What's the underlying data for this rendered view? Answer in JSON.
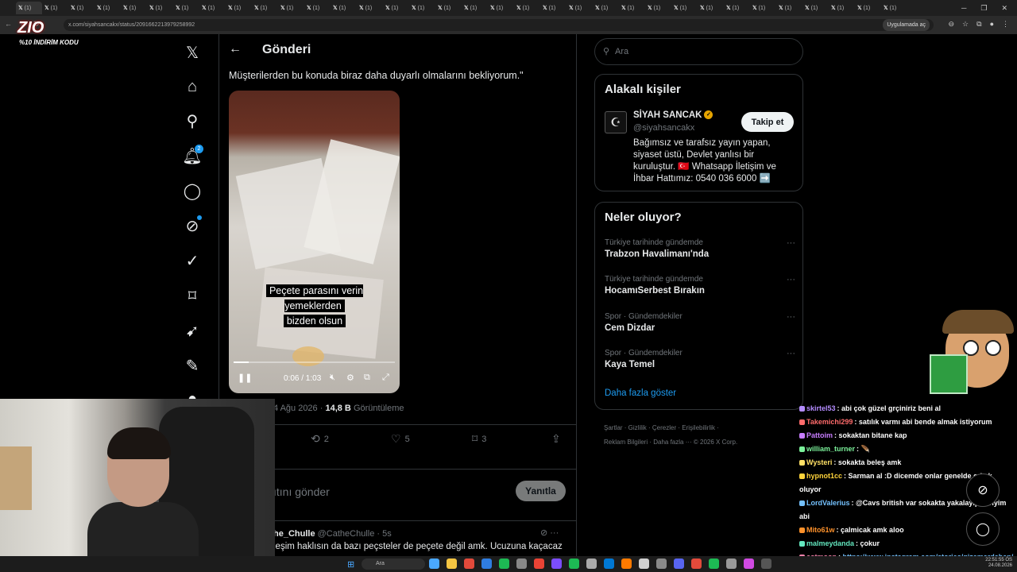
{
  "browser": {
    "tab_label": "(1)",
    "url": "x.com/siyahsancakx/status/2091662213979258992",
    "app_mode": "Uygulamada aç"
  },
  "overlay": {
    "brand": "ZIO",
    "promo": "%10 İNDİRİM KODU"
  },
  "nav": {
    "notification_count": "2"
  },
  "post": {
    "header_title": "Gönderi",
    "text": "Müşterilerden bu konuda biraz daha duyarlı olmalarını bekliyorum.\"",
    "video_caption_line1": "Peçete parasını verin yemeklerden",
    "video_caption_line2": "bizden olsun",
    "video_time": "0:06 / 1:03",
    "video_progress": 0.095,
    "date": "4 Ağu 2026",
    "views_count": "14,8 B",
    "views_label": "Görüntüleme",
    "reposts": "2",
    "likes": "5",
    "bookmarks": "3",
    "reply_placeholder": "ıtını gönder",
    "reply_button": "Yanıtla"
  },
  "reply": {
    "author": "he_Chulle",
    "handle": "@CatheChulle",
    "time": "· 5s",
    "text": "leşim haklısın da bazı peçsteler de peçete değil amk. Ucuzuna kaçacaz"
  },
  "sidebar": {
    "search_placeholder": "Ara",
    "relevant_title": "Alakalı kişiler",
    "person_name": "SİYAH SANCAK",
    "person_handle": "@siyahsancakx",
    "follow_label": "Takip et",
    "bio": "Bağımsız ve tarafsız yayın yapan, siyaset üstü, Devlet yanlısı bir kuruluştur. 🇹🇷 Whatsapp İletişim ve İhbar Hattımız: 0540 036 6000 ➡️",
    "happening_title": "Neler oluyor?",
    "trends": [
      {
        "context": "Türkiye tarihinde gündemde",
        "name": "Trabzon Havalimanı'nda"
      },
      {
        "context": "Türkiye tarihinde gündemde",
        "name": "HocamıSerbest Bırakın"
      },
      {
        "context": "Spor · Gündemdekiler",
        "name": "Cem Dizdar"
      },
      {
        "context": "Spor · Gündemdekiler",
        "name": "Kaya Temel"
      }
    ],
    "show_more": "Daha fazla göster",
    "footer_line1": "Şartlar · Gizlilik · Çerezler · Erişilebilirlik ·",
    "footer_line2": "Reklam Bilgileri · Daha fazla ··· © 2026 X Corp."
  },
  "chat": [
    {
      "user": "skirtel53",
      "color": "#b48cff",
      "msg": "abi çok güzel grçiniriz beni al"
    },
    {
      "user": "Takemichi299",
      "color": "#ff6b6b",
      "msg": "satılık varmı abi bende almak istiyorum"
    },
    {
      "user": "Pattoim",
      "color": "#c77dff",
      "msg": "sokaktan bitane kap"
    },
    {
      "user": "william_turner",
      "color": "#7cf29b",
      "msg": "🪶"
    },
    {
      "user": "Wysteri",
      "color": "#ffe066",
      "msg": "sokakta beleş amk"
    },
    {
      "user": "hypnot1cc",
      "color": "#ffd43b",
      "msg": "Sarman al :D dicemde onlar genelde erkek oluyor"
    },
    {
      "user": "LordValerius",
      "color": "#74c0fc",
      "msg": "@Cavs british var sokakta yakalayıp veriyim abi"
    },
    {
      "user": "Mito61w",
      "color": "#ff922b",
      "msg": "çalmicak amk aloo"
    },
    {
      "user": "malmeydanda",
      "color": "#63e6be",
      "msg": "çokur"
    },
    {
      "user": "cotmoon",
      "color": "#f783ac",
      "msg": "https://www.instagram.com/stories/gizemardahan/3970144347646754565/ BEN BULDUM SANA BUNLARI ALALIM"
    }
  ],
  "taskbar": {
    "search": "Ara",
    "clock_time": "22:51:55 ÖS",
    "clock_date": "24.08.2026"
  }
}
